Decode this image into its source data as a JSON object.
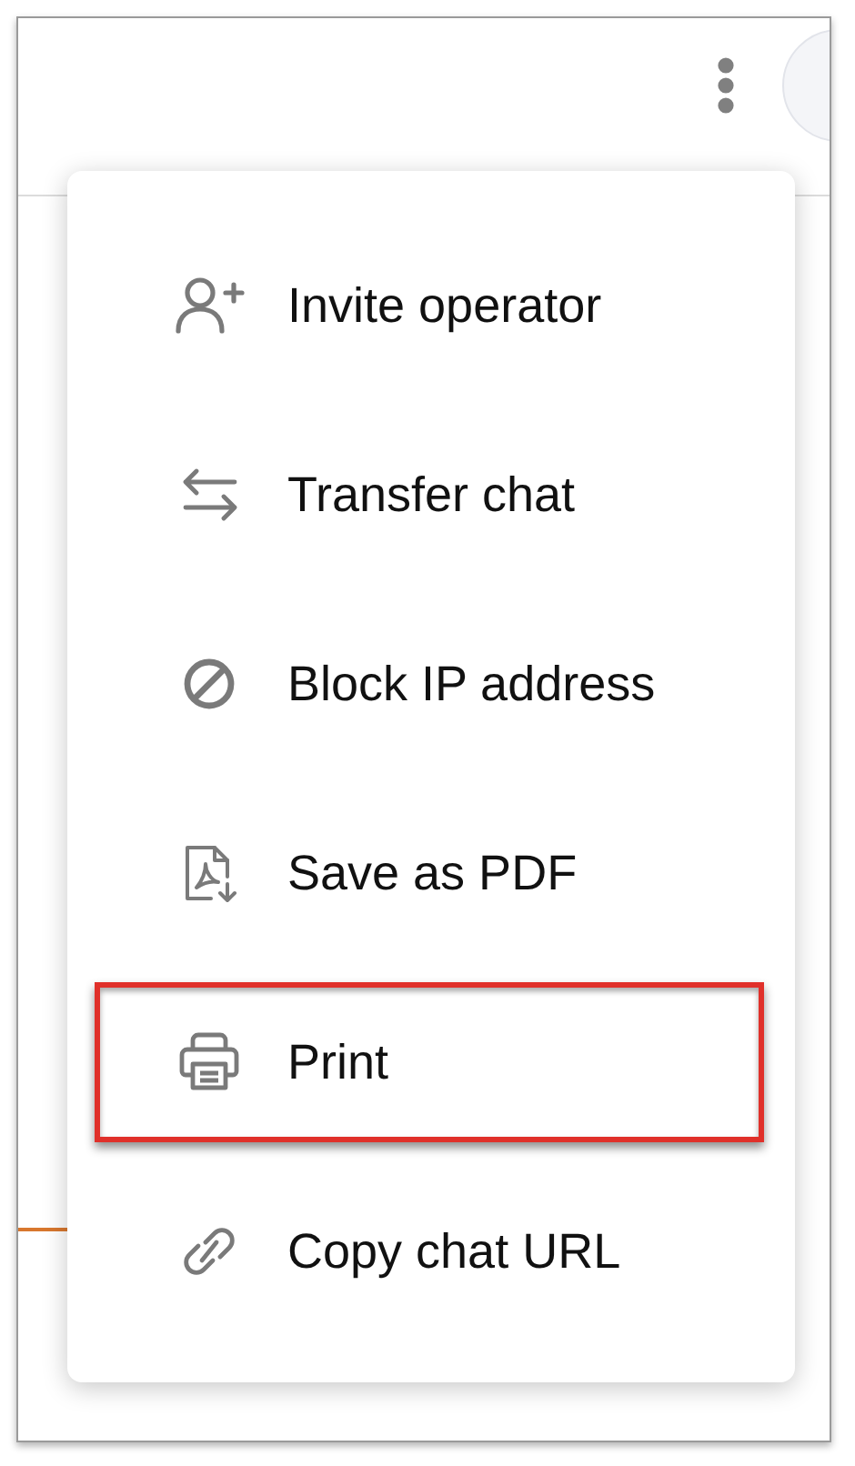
{
  "menu": {
    "items": [
      {
        "kind": "invite",
        "label": "Invite operator",
        "highlighted": false
      },
      {
        "kind": "transfer",
        "label": "Transfer chat",
        "highlighted": false
      },
      {
        "kind": "block",
        "label": "Block IP address",
        "highlighted": false
      },
      {
        "kind": "pdf",
        "label": "Save as PDF",
        "highlighted": false
      },
      {
        "kind": "print",
        "label": "Print",
        "highlighted": true
      },
      {
        "kind": "link",
        "label": "Copy chat URL",
        "highlighted": false
      }
    ]
  }
}
